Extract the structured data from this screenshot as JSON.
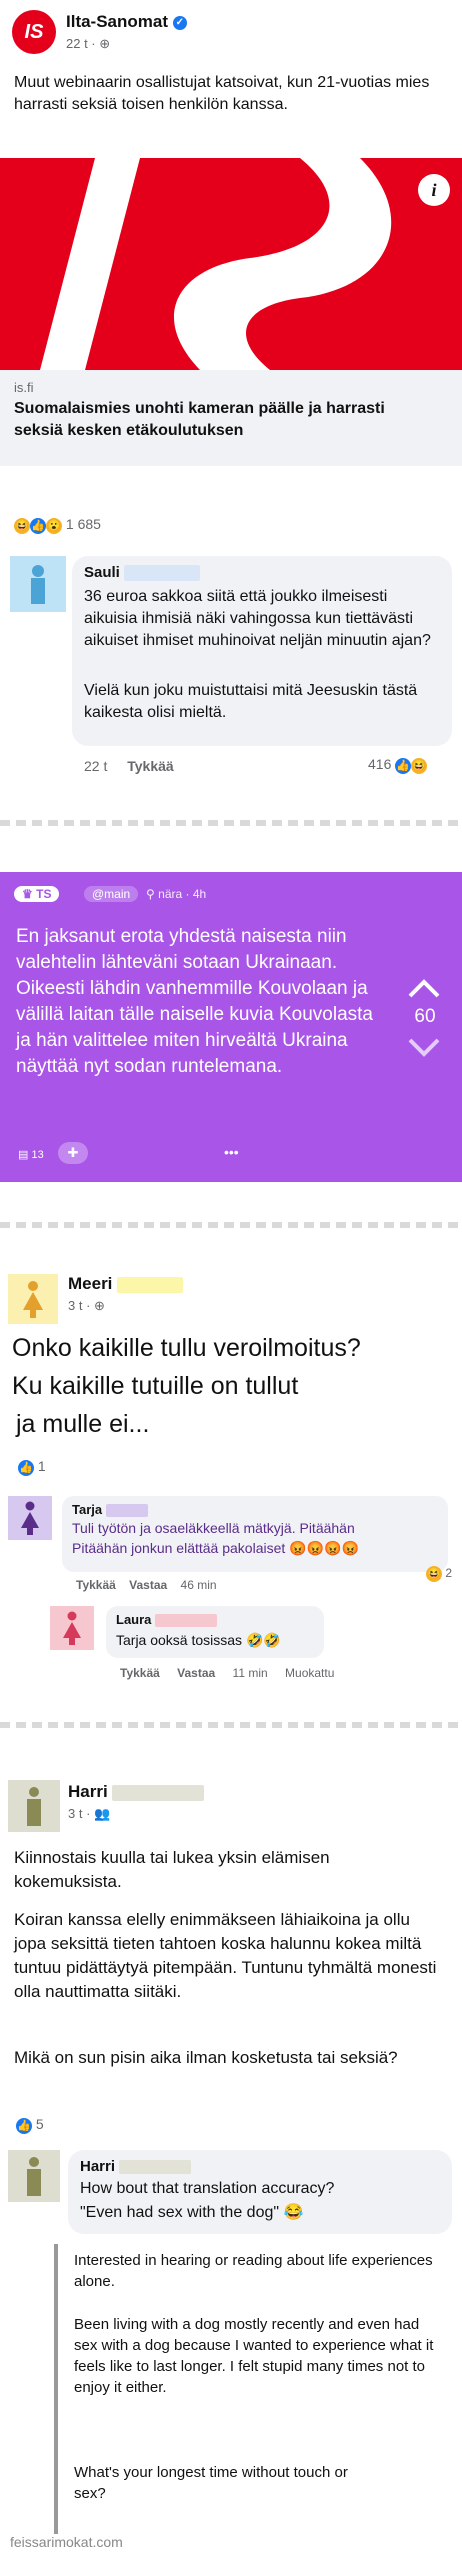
{
  "post1": {
    "page_name": "Ilta-Sanomat",
    "logo_text": "IS",
    "time": "22 t ·",
    "text": "Muut webinaarin osallistujat katsoivat, kun 21-vuotias mies harrasti seksiä toisen henkilön kanssa.",
    "link_domain": "is.fi",
    "link_title": "Suomalaismies unohti kameran päälle ja harrasti seksiä kesken etäkoulutuksen",
    "reaction_count": "1 685",
    "comment": {
      "author": "Sauli",
      "text_1": "36 euroa sakkoa siitä että joukko ilmeisesti aikuisia ihmisiä näki vahingossa kun tiettävästi aikuiset ihmiset muhinoivat neljän minuutin ajan?",
      "text_2": "Vielä kun joku muistuttaisi mitä Jeesuskin tästä kaikesta olisi mieltä.",
      "time": "22 t",
      "like": "Tykkää",
      "count": "416"
    }
  },
  "post2": {
    "badge": "TS",
    "channel": "@main",
    "location": "nära · 4h",
    "text": "En jaksanut erota yhdestä naisesta niin valehtelin lähteväni sotaan Ukrainaan. Oikeesti lähdin vanhemmille Kouvolaan ja välillä laitan tälle naiselle kuvia Kouvolasta ja hän valittelee miten hirveältä Ukraina näyttää nyt sodan runtelemana.",
    "votes": "60",
    "comments": "13",
    "more": "•••"
  },
  "post3": {
    "author": "Meeri",
    "time": "3 t ·",
    "text_1": "Onko kaikille tullu veroilmoitus?",
    "text_2": "Ku kaikille tutuille on tullut",
    "text_3": "ja mulle ei...",
    "likes": "1",
    "comment1": {
      "author": "Tarja",
      "text_1": "Tuli työtön ja osaeläkkeellä mätkyjä. Pitäähän",
      "text_2": "Pitäähän jonkun elättää pakolaiset",
      "like": "Tykkää",
      "reply": "Vastaa",
      "time": "46 min",
      "count": "2"
    },
    "comment2": {
      "author": "Laura",
      "text": "Tarja ooksä tosissas",
      "like": "Tykkää",
      "reply": "Vastaa",
      "time": "11 min",
      "edited": "Muokattu"
    }
  },
  "post4": {
    "author": "Harri",
    "time": "3 t ·",
    "text_1": "Kiinnostais kuulla tai lukea yksin elämisen kokemuksista.",
    "text_2": "Koiran kanssa elelly enimmäkseen lähiaikoina ja ollu jopa seksittä tieten tahtoen koska halunnu kokea miltä tuntuu pidättäytyä pitempään. Tuntunu tyhmältä monesti olla nauttimatta siitäki.",
    "text_3": "Mikä on sun pisin aika ilman kosketusta tai seksiä?",
    "likes": "5",
    "comment": {
      "author": "Harri",
      "text_1": "How bout that translation accuracy?",
      "text_2": "\"Even had sex with the dog\""
    },
    "translation": {
      "p1": "Interested in hearing or reading about life experiences alone.",
      "p2": "Been living with a dog mostly recently and even had sex with a dog because I wanted to experience what it feels like to last longer. I felt stupid many times not to enjoy it either.",
      "p3": "What's your longest time without touch or sex?"
    }
  },
  "watermark": "feissarimokat.com",
  "colors": {
    "is_red": "#e4001b",
    "fb_blue": "#1877f2",
    "jodel_purple": "#a855e8"
  }
}
